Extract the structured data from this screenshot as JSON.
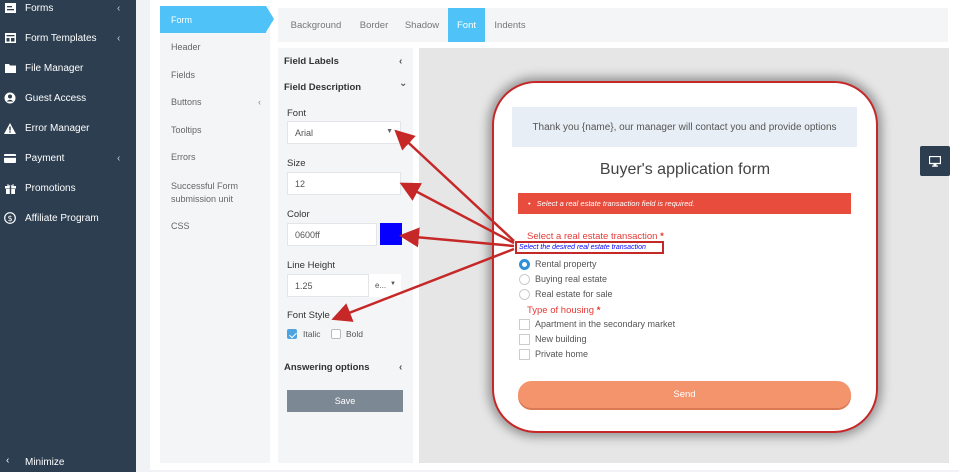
{
  "sidebar": {
    "items": [
      {
        "label": "Forms",
        "icon": "forms-icon",
        "chevron": "‹"
      },
      {
        "label": "Form Templates",
        "icon": "templates-icon",
        "chevron": "‹"
      },
      {
        "label": "File Manager",
        "icon": "file-manager-icon",
        "chevron": ""
      },
      {
        "label": "Guest Access",
        "icon": "guest-access-icon",
        "chevron": ""
      },
      {
        "label": "Error Manager",
        "icon": "warning-icon",
        "chevron": ""
      },
      {
        "label": "Payment",
        "icon": "payment-icon",
        "chevron": "‹"
      },
      {
        "label": "Promotions",
        "icon": "gift-icon",
        "chevron": ""
      },
      {
        "label": "Affiliate Program",
        "icon": "dollar-icon",
        "chevron": ""
      }
    ],
    "minimize": {
      "label": "Minimize",
      "chevron": "‹"
    }
  },
  "subnav": {
    "items": [
      {
        "label": "Form",
        "active": true
      },
      {
        "label": "Header"
      },
      {
        "label": "Fields"
      },
      {
        "label": "Buttons",
        "chevron": "‹"
      },
      {
        "label": "Tooltips"
      },
      {
        "label": "Errors"
      },
      {
        "label": "Successful Form submission unit"
      },
      {
        "label": "CSS"
      }
    ]
  },
  "tabs": [
    {
      "label": "Background"
    },
    {
      "label": "Border"
    },
    {
      "label": "Shadow"
    },
    {
      "label": "Font",
      "active": true
    },
    {
      "label": "Indents"
    }
  ],
  "settings": {
    "field_labels": "Field Labels",
    "field_description": "Field Description",
    "font_label": "Font",
    "font_value": "Arial",
    "size_label": "Size",
    "size_value": "12",
    "color_label": "Color",
    "color_value": "0600ff",
    "line_height_label": "Line Height",
    "line_height_value": "1.25",
    "line_height_unit": "e...",
    "font_style_label": "Font Style",
    "italic_label": "Italic",
    "italic_checked": true,
    "bold_label": "Bold",
    "bold_checked": false,
    "answering_options": "Answering options",
    "save_label": "Save",
    "chevron_left": "‹",
    "chevron_down": "⌄",
    "caret": "▼"
  },
  "preview": {
    "thanks_text": "Thank you {name}, our manager will contact you and provide options",
    "title": "Buyer's application form",
    "error_text": "Select a real estate transaction field is required.",
    "q1_label": "Select a real estate transaction",
    "q1_description": "Select the desired real estate transaction",
    "required_mark": "*",
    "q1_options": [
      "Rental property",
      "Buying real estate",
      "Real estate for sale"
    ],
    "q1_selected": 0,
    "q2_label": "Type of housing",
    "q2_options": [
      "Apartment in the secondary market",
      "New building",
      "Private home"
    ],
    "send_label": "Send"
  },
  "colors": {
    "sidebar": "#2c3e50",
    "accent": "#4fc3f7",
    "error": "#e74c3c",
    "annotation": "#c62828",
    "description_font": "#0600ff",
    "send": "#f4946c"
  },
  "device_toggle_icon": "desktop-icon"
}
